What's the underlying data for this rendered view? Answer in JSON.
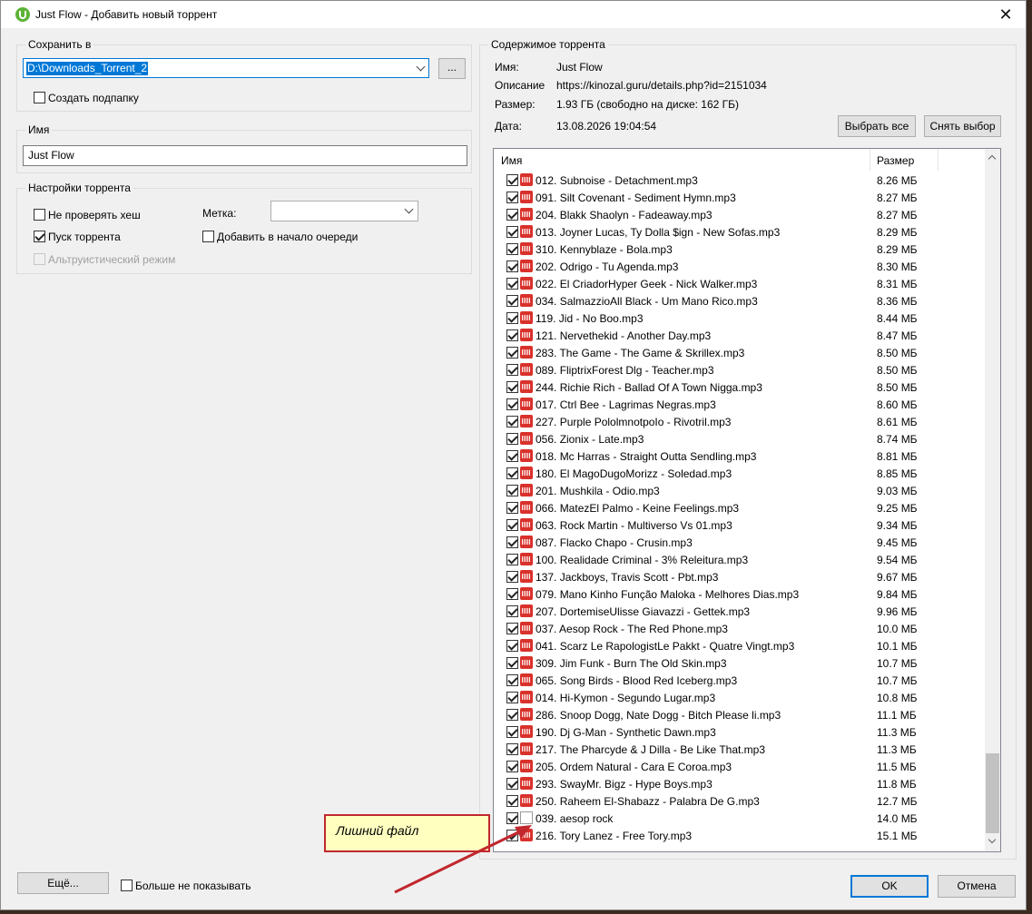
{
  "window": {
    "title": "Just Flow - Добавить новый торрент",
    "close": "✕"
  },
  "save": {
    "group_label": "Сохранить в",
    "path": "D:\\Downloads_Torrent_2",
    "browse_label": "...",
    "create_subfolder_label": "Создать подпапку",
    "create_subfolder_checked": false
  },
  "name_group": {
    "label": "Имя",
    "value": "Just Flow"
  },
  "settings": {
    "group_label": "Настройки торрента",
    "skip_hash_label": "Не проверять хеш",
    "skip_hash_checked": false,
    "start_label": "Пуск торрента",
    "start_checked": true,
    "altruistic_label": "Альтруистический режим",
    "tag_label": "Метка:",
    "tag_value": "",
    "queue_top_label": "Добавить в начало очереди",
    "queue_top_checked": false
  },
  "contents": {
    "group_label": "Содержимое торрента",
    "name_key": "Имя:",
    "name_val": "Just Flow",
    "desc_key": "Описание",
    "desc_val": "https://kinozal.guru/details.php?id=2151034",
    "size_key": "Размер:",
    "size_val": "1.93 ГБ (свободно на диске: 162 ГБ)",
    "date_key": "Дата:",
    "date_val": "13.08.2026 19:04:54",
    "select_all": "Выбрать все",
    "deselect": "Снять выбор",
    "col_name": "Имя",
    "col_size": "Размер",
    "scroll_position": 0.88
  },
  "files": [
    {
      "name": "012. Subnoise - Detachment.mp3",
      "size": "8.26 МБ",
      "icon": "audio-file-icon"
    },
    {
      "name": "091. Silt Covenant - Sediment Hymn.mp3",
      "size": "8.27 МБ",
      "icon": "audio-file-icon"
    },
    {
      "name": "204. Blakk Shaolyn - Fadeaway.mp3",
      "size": "8.27 МБ",
      "icon": "audio-file-icon"
    },
    {
      "name": "013. Joyner Lucas, Ty Dolla $ign - New Sofas.mp3",
      "size": "8.29 МБ",
      "icon": "audio-file-icon"
    },
    {
      "name": "310. Kennyblaze - Bola.mp3",
      "size": "8.29 МБ",
      "icon": "audio-file-icon"
    },
    {
      "name": "202. Odrigo - Tu Agenda.mp3",
      "size": "8.30 МБ",
      "icon": "audio-file-icon"
    },
    {
      "name": "022. El CriadorHyper Geek - Nick Walker.mp3",
      "size": "8.31 МБ",
      "icon": "audio-file-icon"
    },
    {
      "name": "034. SalmazzioAll Black - Um Mano Rico.mp3",
      "size": "8.36 МБ",
      "icon": "audio-file-icon"
    },
    {
      "name": "119. Jid - No Boo.mp3",
      "size": "8.44 МБ",
      "icon": "audio-file-icon"
    },
    {
      "name": "121. Nervethekid - Another Day.mp3",
      "size": "8.47 МБ",
      "icon": "audio-file-icon"
    },
    {
      "name": "283. The Game - The Game & Skrillex.mp3",
      "size": "8.50 МБ",
      "icon": "audio-file-icon"
    },
    {
      "name": "089. FliptrixForest Dlg - Teacher.mp3",
      "size": "8.50 МБ",
      "icon": "audio-file-icon"
    },
    {
      "name": "244. Richie Rich - Ballad Of A Town Nigga.mp3",
      "size": "8.50 МБ",
      "icon": "audio-file-icon"
    },
    {
      "name": "017. Ctrl Bee - Lagrimas Negras.mp3",
      "size": "8.60 МБ",
      "icon": "audio-file-icon"
    },
    {
      "name": "227. Purple PololmnotpoIo - Rivotril.mp3",
      "size": "8.61 МБ",
      "icon": "audio-file-icon"
    },
    {
      "name": "056. Zionix - Late.mp3",
      "size": "8.74 МБ",
      "icon": "audio-file-icon"
    },
    {
      "name": "018. Mc Harras - Straight Outta Sendling.mp3",
      "size": "8.81 МБ",
      "icon": "audio-file-icon"
    },
    {
      "name": "180. El MagoDugoMorizz - Soledad.mp3",
      "size": "8.85 МБ",
      "icon": "audio-file-icon"
    },
    {
      "name": "201. Mushkila - Odio.mp3",
      "size": "9.03 МБ",
      "icon": "audio-file-icon"
    },
    {
      "name": "066. MatezEl Palmo - Keine Feelings.mp3",
      "size": "9.25 МБ",
      "icon": "audio-file-icon"
    },
    {
      "name": "063. Rock Martin - Multiverso Vs 01.mp3",
      "size": "9.34 МБ",
      "icon": "audio-file-icon"
    },
    {
      "name": "087. Flacko Chapo - Crusin.mp3",
      "size": "9.45 МБ",
      "icon": "audio-file-icon"
    },
    {
      "name": "100. Realidade Criminal - 3% Releitura.mp3",
      "size": "9.54 МБ",
      "icon": "audio-file-icon"
    },
    {
      "name": "137. Jackboys, Travis Scott - Pbt.mp3",
      "size": "9.67 МБ",
      "icon": "audio-file-icon"
    },
    {
      "name": "079. Mano Kinho Função Maloka - Melhores Dias.mp3",
      "size": "9.84 МБ",
      "icon": "audio-file-icon"
    },
    {
      "name": "207. DortemiseUlisse Giavazzi - Gettek.mp3",
      "size": "9.96 МБ",
      "icon": "audio-file-icon"
    },
    {
      "name": "037. Aesop Rock - The Red Phone.mp3",
      "size": "10.0 МБ",
      "icon": "audio-file-icon"
    },
    {
      "name": "041. Scarz Le RapologistLe Pakkt - Quatre Vingt.mp3",
      "size": "10.1 МБ",
      "icon": "audio-file-icon"
    },
    {
      "name": "309. Jim Funk - Burn The Old Skin.mp3",
      "size": "10.7 МБ",
      "icon": "audio-file-icon"
    },
    {
      "name": "065. Song Birds - Blood Red Iceberg.mp3",
      "size": "10.7 МБ",
      "icon": "audio-file-icon"
    },
    {
      "name": "014. Hi-Kymon - Segundo Lugar.mp3",
      "size": "10.8 МБ",
      "icon": "audio-file-icon"
    },
    {
      "name": "286. Snoop Dogg, Nate Dogg - Bitch Please li.mp3",
      "size": "11.1 МБ",
      "icon": "audio-file-icon"
    },
    {
      "name": "190. Dj G-Man - Synthetic Dawn.mp3",
      "size": "11.3 МБ",
      "icon": "audio-file-icon"
    },
    {
      "name": "217. The Pharcyde & J Dilla - Be Like That.mp3",
      "size": "11.3 МБ",
      "icon": "audio-file-icon"
    },
    {
      "name": "205. Ordem Natural - Cara E Coroa.mp3",
      "size": "11.5 МБ",
      "icon": "audio-file-icon"
    },
    {
      "name": "293. SwayMr. Bigz - Hype Boys.mp3",
      "size": "11.8 МБ",
      "icon": "audio-file-icon"
    },
    {
      "name": "250. Raheem El-Shabazz - Palabra De G.mp3",
      "size": "12.7 МБ",
      "icon": "audio-file-icon"
    },
    {
      "name": "039. aesop rock",
      "size": "14.0 МБ",
      "icon": "blank-file-icon"
    },
    {
      "name": "216. Tory Lanez - Free Tory.mp3",
      "size": "15.1 МБ",
      "icon": "audio-file-icon"
    }
  ],
  "footer": {
    "more_label": "Ещё...",
    "dont_show_label": "Больше не показывать",
    "ok_label": "OK",
    "cancel_label": "Отмена"
  },
  "callout": {
    "text": "Лишний файл",
    "color": "#c1272d"
  },
  "colors": {
    "accent": "#0078d7",
    "logo": "#5cb335"
  }
}
